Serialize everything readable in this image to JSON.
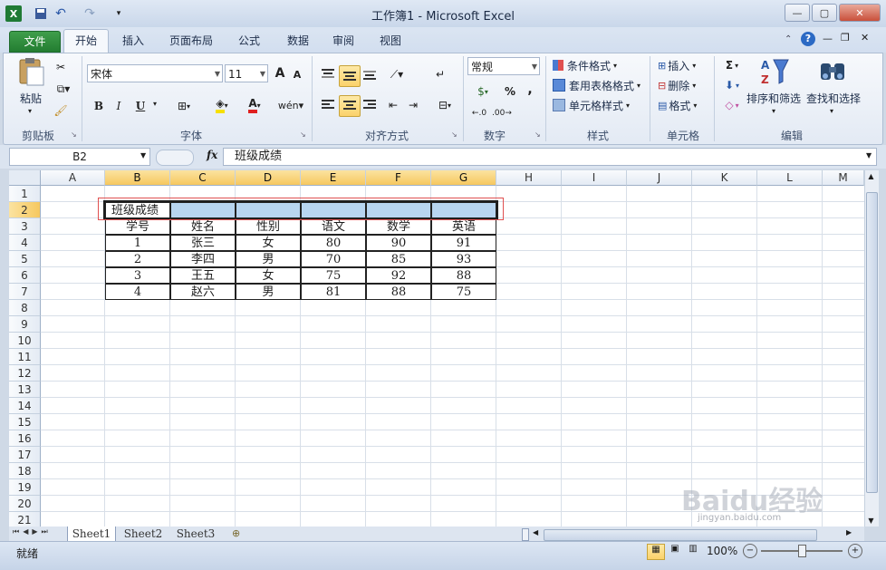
{
  "window": {
    "title": "工作簿1 - Microsoft Excel"
  },
  "tabs": [
    "文件",
    "开始",
    "插入",
    "页面布局",
    "公式",
    "数据",
    "审阅",
    "视图"
  ],
  "ribbon": {
    "clipboard": {
      "paste": "粘贴",
      "label": "剪贴板"
    },
    "font": {
      "name": "宋体",
      "size": "11",
      "label": "字体",
      "grow": "A",
      "shrink": "A",
      "bold": "B",
      "italic": "I",
      "underline": "U",
      "fontcolor": "A"
    },
    "alignment": {
      "label": "对齐方式"
    },
    "number": {
      "format": "常规",
      "label": "数字",
      "percent": "%",
      "comma": ","
    },
    "styles": {
      "conditional": "条件格式",
      "table": "套用表格格式",
      "cell": "单元格样式",
      "label": "样式"
    },
    "cells": {
      "insert": "插入",
      "delete": "删除",
      "format": "格式",
      "label": "单元格"
    },
    "editing": {
      "sort": "排序和筛选",
      "find": "查找和选择",
      "label": "编辑",
      "sigma": "Σ"
    }
  },
  "formula_bar": {
    "name_box": "B2",
    "fx": "fx",
    "content": "班级成绩"
  },
  "columns": [
    "A",
    "B",
    "C",
    "D",
    "E",
    "F",
    "G",
    "H",
    "I",
    "J",
    "K",
    "L",
    "M"
  ],
  "rows": [
    "1",
    "2",
    "3",
    "4",
    "5",
    "6",
    "7",
    "8",
    "9",
    "10",
    "11",
    "12",
    "13",
    "14",
    "15",
    "16",
    "17",
    "18",
    "19",
    "20",
    "21"
  ],
  "sheet": {
    "title_cell": "班级成绩",
    "headers": [
      "学号",
      "姓名",
      "性别",
      "语文",
      "数学",
      "英语"
    ],
    "data": [
      [
        "1",
        "张三",
        "女",
        "80",
        "90",
        "91"
      ],
      [
        "2",
        "李四",
        "男",
        "70",
        "85",
        "93"
      ],
      [
        "3",
        "王五",
        "女",
        "75",
        "92",
        "88"
      ],
      [
        "4",
        "赵六",
        "男",
        "81",
        "88",
        "75"
      ]
    ]
  },
  "sheet_tabs": [
    "Sheet1",
    "Sheet2",
    "Sheet3"
  ],
  "status": {
    "ready": "就绪",
    "zoom": "100%"
  },
  "watermark": {
    "text": "Baidu经验",
    "url": "jingyan.baidu.com"
  },
  "colors": {
    "selection": "#b8d5f0",
    "highlight_border": "#e05050",
    "file_tab": "#2f8c3c"
  }
}
